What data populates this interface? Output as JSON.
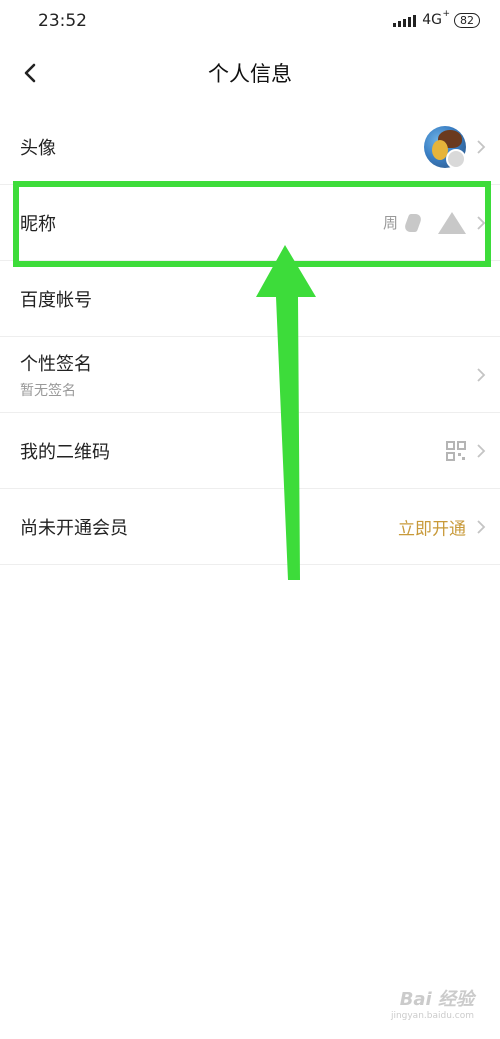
{
  "status_bar": {
    "time": "23:52",
    "network": "4G",
    "network_sup": "+",
    "battery": "82"
  },
  "nav": {
    "title": "个人信息"
  },
  "rows": [
    {
      "label": "头像"
    },
    {
      "label": "昵称",
      "value": "周"
    },
    {
      "label": "百度帐号"
    },
    {
      "label": "个性签名",
      "sub": "暂无签名"
    },
    {
      "label": "我的二维码"
    },
    {
      "label": "尚未开通会员",
      "action": "立即开通"
    }
  ],
  "colors": {
    "highlight": "#3ddc3a",
    "vip_action": "#c89a3a",
    "divider": "#eeeeee"
  },
  "icons": [
    "back-arrow-icon",
    "chevron-right-icon",
    "qr-code-icon",
    "avatar-badge-icon"
  ],
  "watermark": {
    "main": "Bai 经验",
    "sub": "jingyan.baidu.com"
  }
}
